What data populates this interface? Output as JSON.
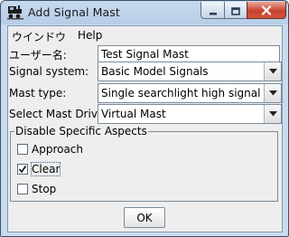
{
  "window": {
    "title": "Add Signal Mast",
    "app_icon": "railroad-engine-icon",
    "controls": {
      "minimize": "minimize-icon",
      "maximize": "maximize-icon",
      "close": "close-icon"
    }
  },
  "menu": {
    "items": [
      {
        "label": "ウインドウ"
      },
      {
        "label": "Help"
      }
    ]
  },
  "form": {
    "user_name": {
      "label": "ユーザー名:",
      "value": "Test Signal Mast"
    },
    "signal_system": {
      "label": "Signal system:",
      "value": "Basic Model Signals"
    },
    "mast_type": {
      "label": "Mast type:",
      "value": "Single searchlight high signal"
    },
    "mast_driver": {
      "label": "Select Mast Driver:",
      "value": "Virtual Mast"
    }
  },
  "aspects": {
    "title": "Disable Specific Aspects",
    "items": [
      {
        "label": "Approach",
        "checked": false
      },
      {
        "label": "Clear",
        "checked": true
      },
      {
        "label": "Stop",
        "checked": false
      }
    ]
  },
  "ok_label": "OK",
  "colors": {
    "window_frame": "#c9dcef",
    "close_button": "#c7432c",
    "panel": "#eeeeee"
  }
}
